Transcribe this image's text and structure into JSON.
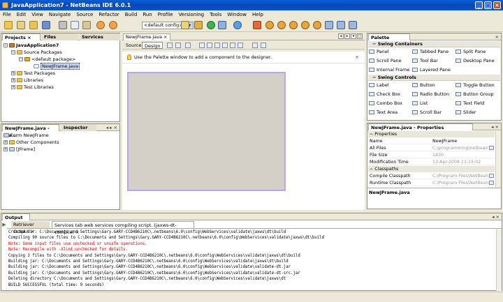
{
  "window": {
    "title": "JavaApplication7 - NetBeans IDE 6.0.1",
    "minimize": "_",
    "maximize": "□",
    "close": "×"
  },
  "menu": [
    "File",
    "Edit",
    "View",
    "Navigate",
    "Source",
    "Refactor",
    "Build",
    "Run",
    "Profile",
    "Versioning",
    "Tools",
    "Window",
    "Help"
  ],
  "toolbar": {
    "config": "<default config>",
    "config_arrow": "▾"
  },
  "projects_panel": {
    "tabs": [
      "Projects",
      "Files",
      "Services"
    ],
    "close": "×",
    "tree": [
      {
        "label": "JavaApplication7",
        "toggle": "−"
      },
      {
        "label": "Source Packages",
        "toggle": "−"
      },
      {
        "label": "<default package>",
        "toggle": "−"
      },
      {
        "label": "NewJFrame.java",
        "toggle": ""
      },
      {
        "label": "Test Packages",
        "toggle": "+"
      },
      {
        "label": "Libraries",
        "toggle": "+"
      },
      {
        "label": "Test Libraries",
        "toggle": "+"
      }
    ]
  },
  "navigator_panel": {
    "tabs": [
      "NewJFrame.java - Na...",
      "Inspector"
    ],
    "controls": "◂ ▸ ×",
    "tree": [
      {
        "label": "Form NewJFrame",
        "toggle": ""
      },
      {
        "label": "Other Components",
        "toggle": "+"
      },
      {
        "label": "[JFrame]",
        "toggle": "+"
      }
    ]
  },
  "editor": {
    "tab": "NewJFrame.java",
    "tab_close": "×",
    "nav_buttons": [
      "◂",
      "▸",
      "▾",
      "□"
    ],
    "modes": [
      "Source",
      "Design"
    ],
    "hint": "Use the Palette window to add a component to the designer.",
    "hint_close": "×"
  },
  "palette": {
    "title": "Palette",
    "controls": "×",
    "categories": [
      {
        "name": "Swing Containers",
        "toggle": "−",
        "items": [
          "Panel",
          "Tabbed Pane",
          "Split Pane",
          "Scroll Pane",
          "Tool Bar",
          "Desktop Pane",
          "Internal Frame",
          "Layered Pane"
        ]
      },
      {
        "name": "Swing Controls",
        "toggle": "−",
        "items": [
          "Label",
          "Button",
          "Toggle Button",
          "Check Box",
          "Radio Button",
          "Button Group",
          "Combo Box",
          "List",
          "Text Field",
          "Text Area",
          "Scroll Bar",
          "Slider"
        ]
      }
    ]
  },
  "properties": {
    "title": "NewJFrame.java - Properties",
    "controls": "◂ ×",
    "section1": "Properties",
    "section1_toggle": "−",
    "rows1": [
      {
        "key": "Name",
        "value": "NewJFrame"
      },
      {
        "key": "All Files",
        "value": "C:\\programming\\netbeans\\..."
      },
      {
        "key": "File Size",
        "value": "1830"
      },
      {
        "key": "Modification Time",
        "value": "13-Apr-2008 11:15:02"
      }
    ],
    "section2": "Classpaths",
    "section2_toggle": "−",
    "rows2": [
      {
        "key": "Compile Classpath",
        "value": "C:\\Program Files\\NetBeans"
      },
      {
        "key": "Runtime Classpath",
        "value": "C:\\Program Files\\NetBeans"
      }
    ],
    "footer": "NewJFrame.java"
  },
  "output": {
    "title": "Output",
    "controls": "◂ ×",
    "tabs": [
      "Retriever Output",
      "Services tab web services compiling script. (jaxws-dt-compile)"
    ],
    "tab_close": "×",
    "play": "▶",
    "lines": [
      {
        "text": "Created dir: C:\\Documents and Settings\\Gary.GARY-CCD4B6210C\\.netbeans\\6.0\\config\\WebServices\\validate\\jaxws\\dt\\build",
        "error": false
      },
      {
        "text": "Compiling 90 source files to C:\\Documents and Settings\\Gary.GARY-CCD4B6210C\\.netbeans\\6.0\\config\\WebServices\\validate\\jaxws\\dt\\build",
        "error": false
      },
      {
        "text": "Note: Some input files use unchecked or unsafe operations.",
        "error": true
      },
      {
        "text": "Note: Recompile with -Xlint:unchecked for details.",
        "error": true
      },
      {
        "text": "Copying 3 files to C:\\Documents and Settings\\Gary.GARY-CCD4B6210C\\.netbeans\\6.0\\config\\WebServices\\validate\\jaxws\\dt\\build",
        "error": false
      },
      {
        "text": "Building jar: C:\\Documents and Settings\\Gary.GARY-CCD4B6210C\\.netbeans\\6.0\\config\\WebServices\\validate\\jaxws\\dt\\build",
        "error": false
      },
      {
        "text": "Building jar: C:\\Documents and Settings\\Gary.GARY-CCD4B6210C\\.netbeans\\6.0\\config\\WebServices\\validate\\validate-dt.jar",
        "error": false
      },
      {
        "text": "Building jar: C:\\Documents and Settings\\Gary.GARY-CCD4B6210C\\.netbeans\\6.0\\config\\WebServices\\validate\\validate-dt-src.jar",
        "error": false
      },
      {
        "text": "Deleting directory C:\\Documents and Settings\\Gary.GARY-CCD4B6210C\\.netbeans\\6.0\\config\\WebServices\\validate\\jaxws\\dt",
        "error": false
      },
      {
        "text": "BUILD SUCCESSFUL (total time: 9 seconds)",
        "error": false
      }
    ]
  },
  "colors": {
    "titlebar": "#0a55cc",
    "form_border": "#b5a9ec",
    "error_text": "#d00000"
  }
}
